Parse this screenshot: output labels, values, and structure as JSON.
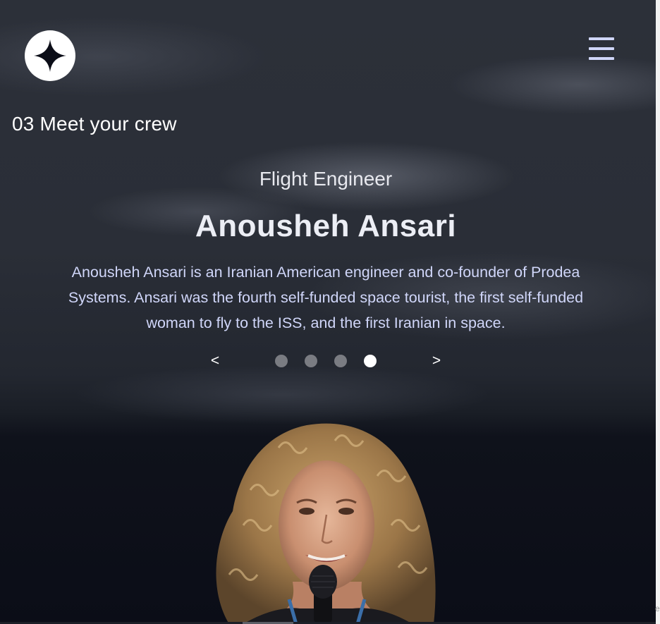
{
  "page": {
    "heading": "03 Meet your crew"
  },
  "icons": {
    "logo": "star-logo-icon",
    "menu": "hamburger-menu-icon"
  },
  "crew": {
    "role": "Flight Engineer",
    "name": "Anousheh Ansari",
    "bio": "Anousheh Ansari is an Iranian American engineer and co-founder of Prodea Systems. Ansari was the fourth self-funded space tourist, the first self-funded woman to fly to the ISS, and the first Iranian in space."
  },
  "carousel": {
    "prev_label": "<",
    "next_label": ">",
    "slide_count": 4,
    "active_index": 3
  },
  "colors": {
    "background": "#0b0d17",
    "accent_text": "#d0d6f9",
    "dot_inactive": "#7a7c82",
    "dot_active": "#ffffff"
  }
}
